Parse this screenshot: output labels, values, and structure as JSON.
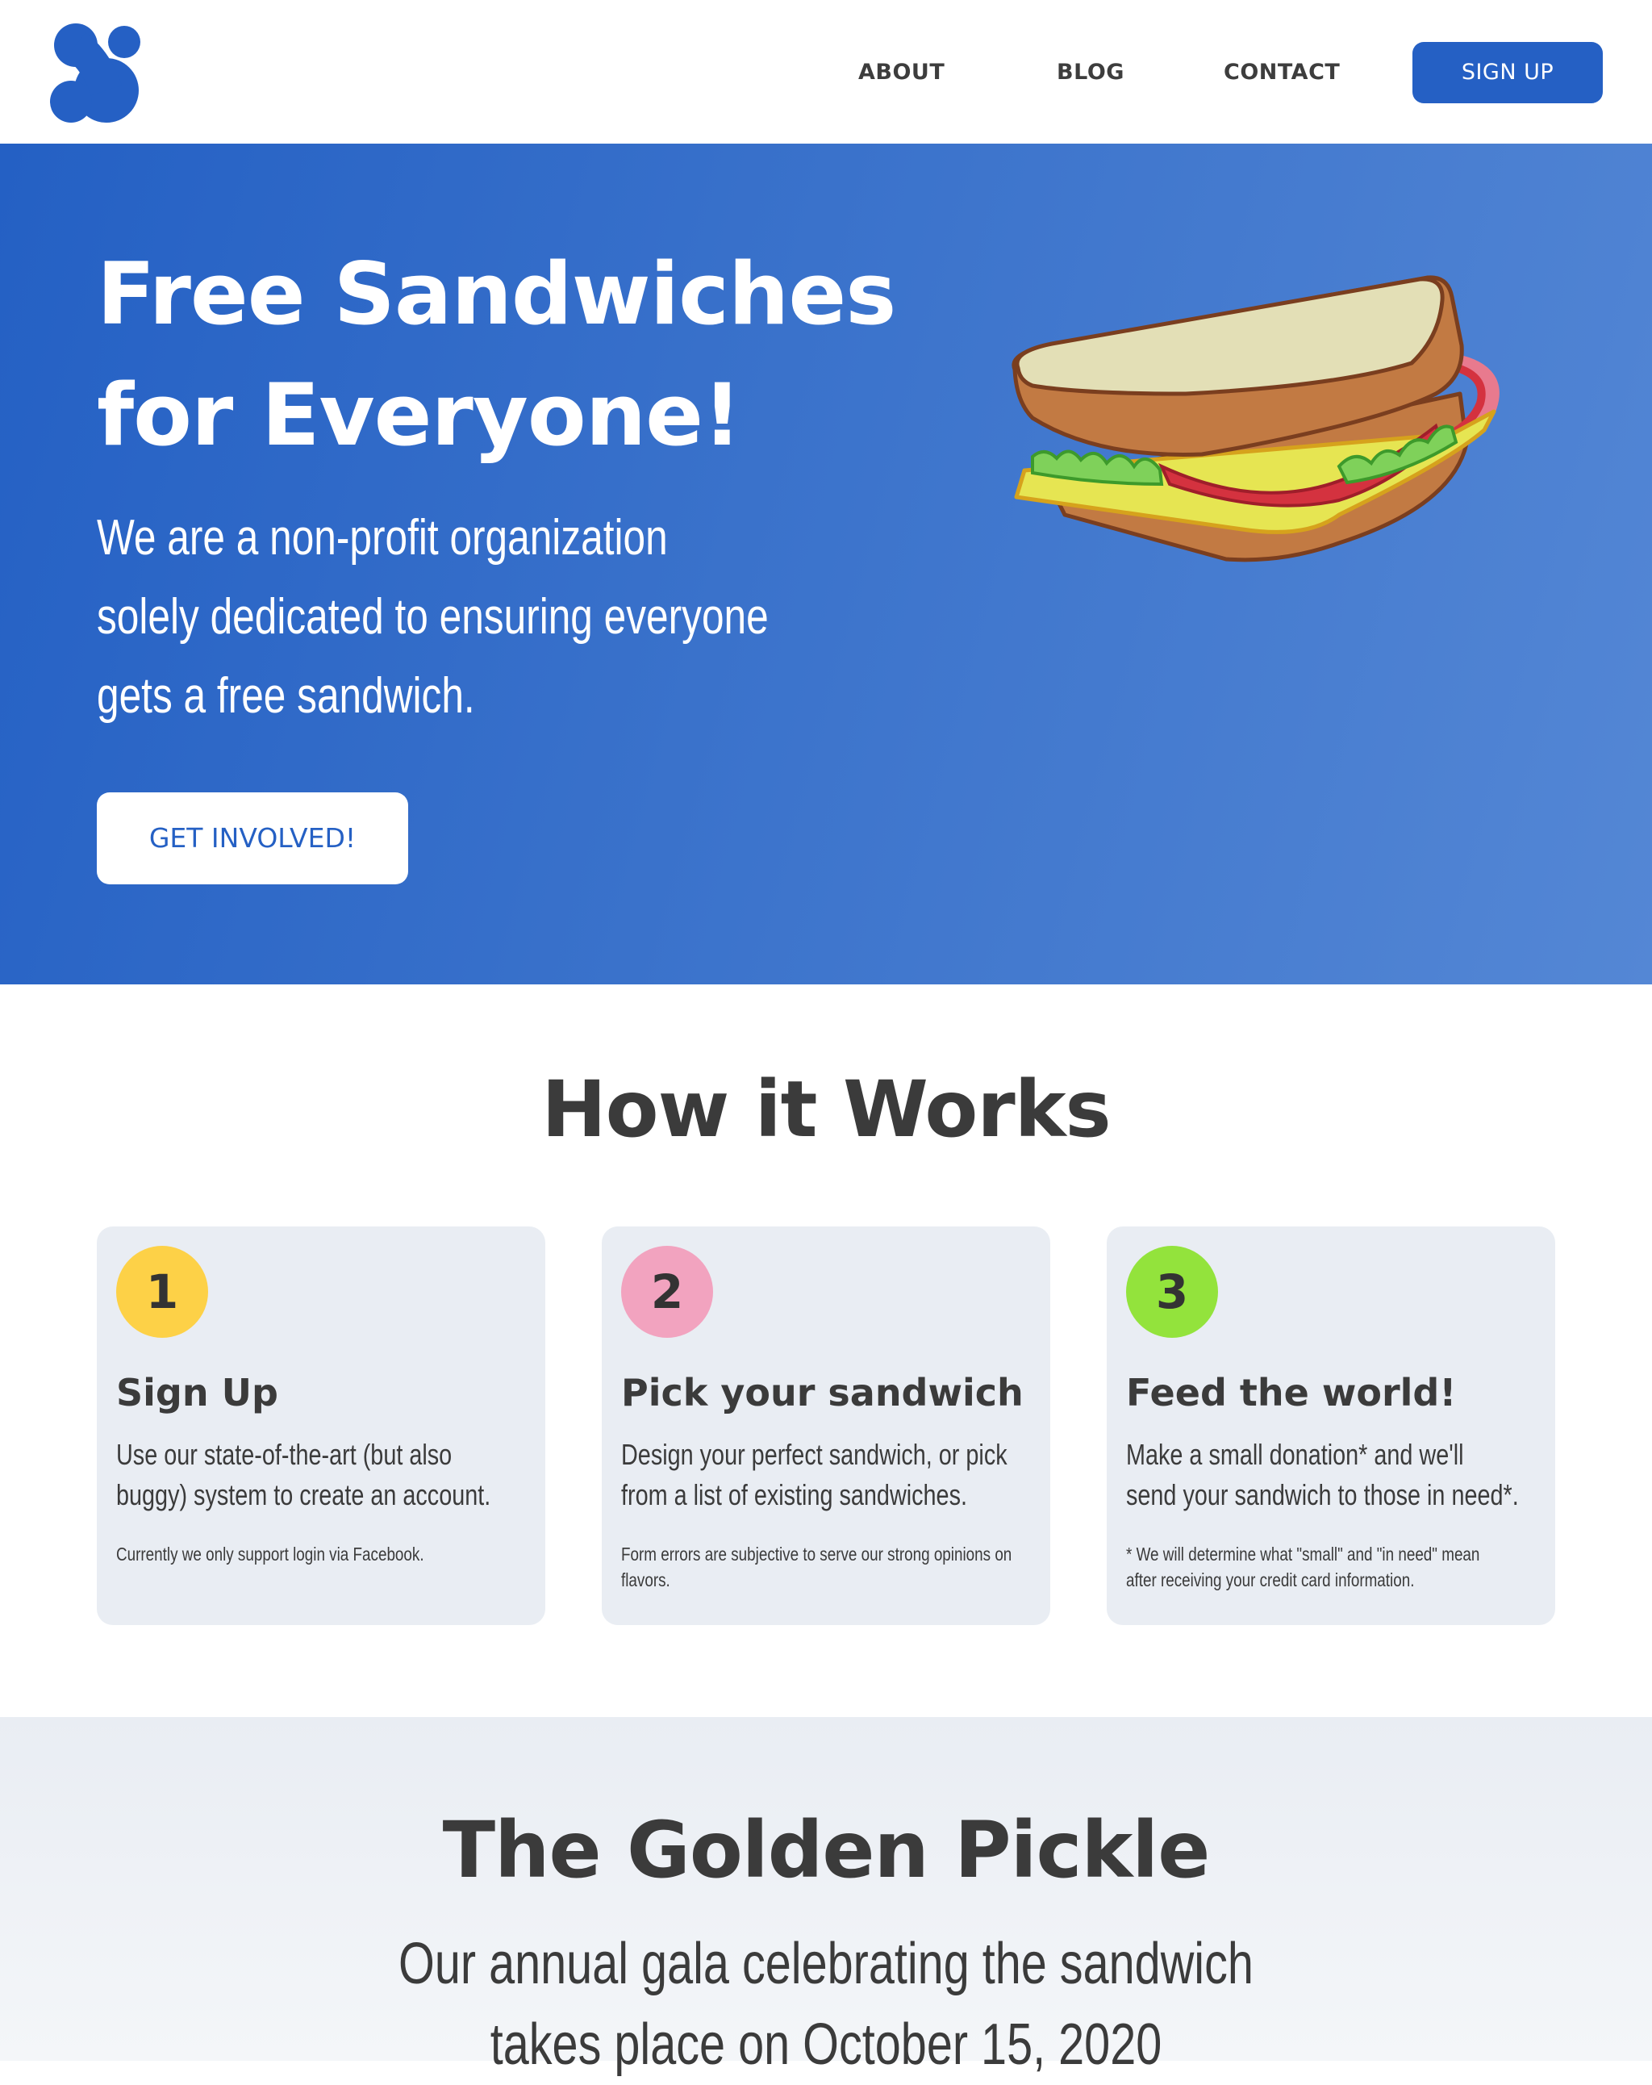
{
  "header": {
    "logo_icon": "s-logo-icon",
    "nav": [
      {
        "label": "ABOUT"
      },
      {
        "label": "BLOG"
      },
      {
        "label": "CONTACT"
      }
    ],
    "signup_label": "SIGN UP"
  },
  "hero": {
    "title_line1": "Free Sandwiches",
    "title_line2": "for Everyone!",
    "text_line1": "We are a non-profit organization",
    "text_line2": "solely dedicated to ensuring everyone",
    "text_line3": "gets a free sandwich.",
    "cta_label": "GET INVOLVED!",
    "illustration": "sandwich-illustration"
  },
  "how": {
    "title": "How it Works",
    "steps": [
      {
        "number": "1",
        "color": "#fdd147",
        "title": "Sign Up",
        "text_line1": "Use our state-of-the-art (but also",
        "text_line2": "buggy) system to create an account.",
        "note_line1": "Currently we only support login via Facebook.",
        "note_line2": ""
      },
      {
        "number": "2",
        "color": "#f2a3bf",
        "title": "Pick your sandwich",
        "text_line1": "Design your perfect sandwich, or pick",
        "text_line2": "from a list of existing sandwiches.",
        "note_line1": "Form errors are subjective to serve our strong opinions on",
        "note_line2": "flavors."
      },
      {
        "number": "3",
        "color": "#93e33c",
        "title": "Feed the world!",
        "text_line1": "Make a small donation* and we'll",
        "text_line2": "send your sandwich to those in need*.",
        "note_line1": "* We will determine what \"small\" and \"in need\" mean",
        "note_line2": "after receiving your credit card information."
      }
    ]
  },
  "gala": {
    "title": "The Golden Pickle",
    "text_line1": "Our annual gala celebrating the sandwich",
    "text_line2": "takes place on October 15, 2020"
  },
  "colors": {
    "brand": "#2560c4",
    "text": "#3b3b3b",
    "card_bg": "#e9edf3"
  }
}
